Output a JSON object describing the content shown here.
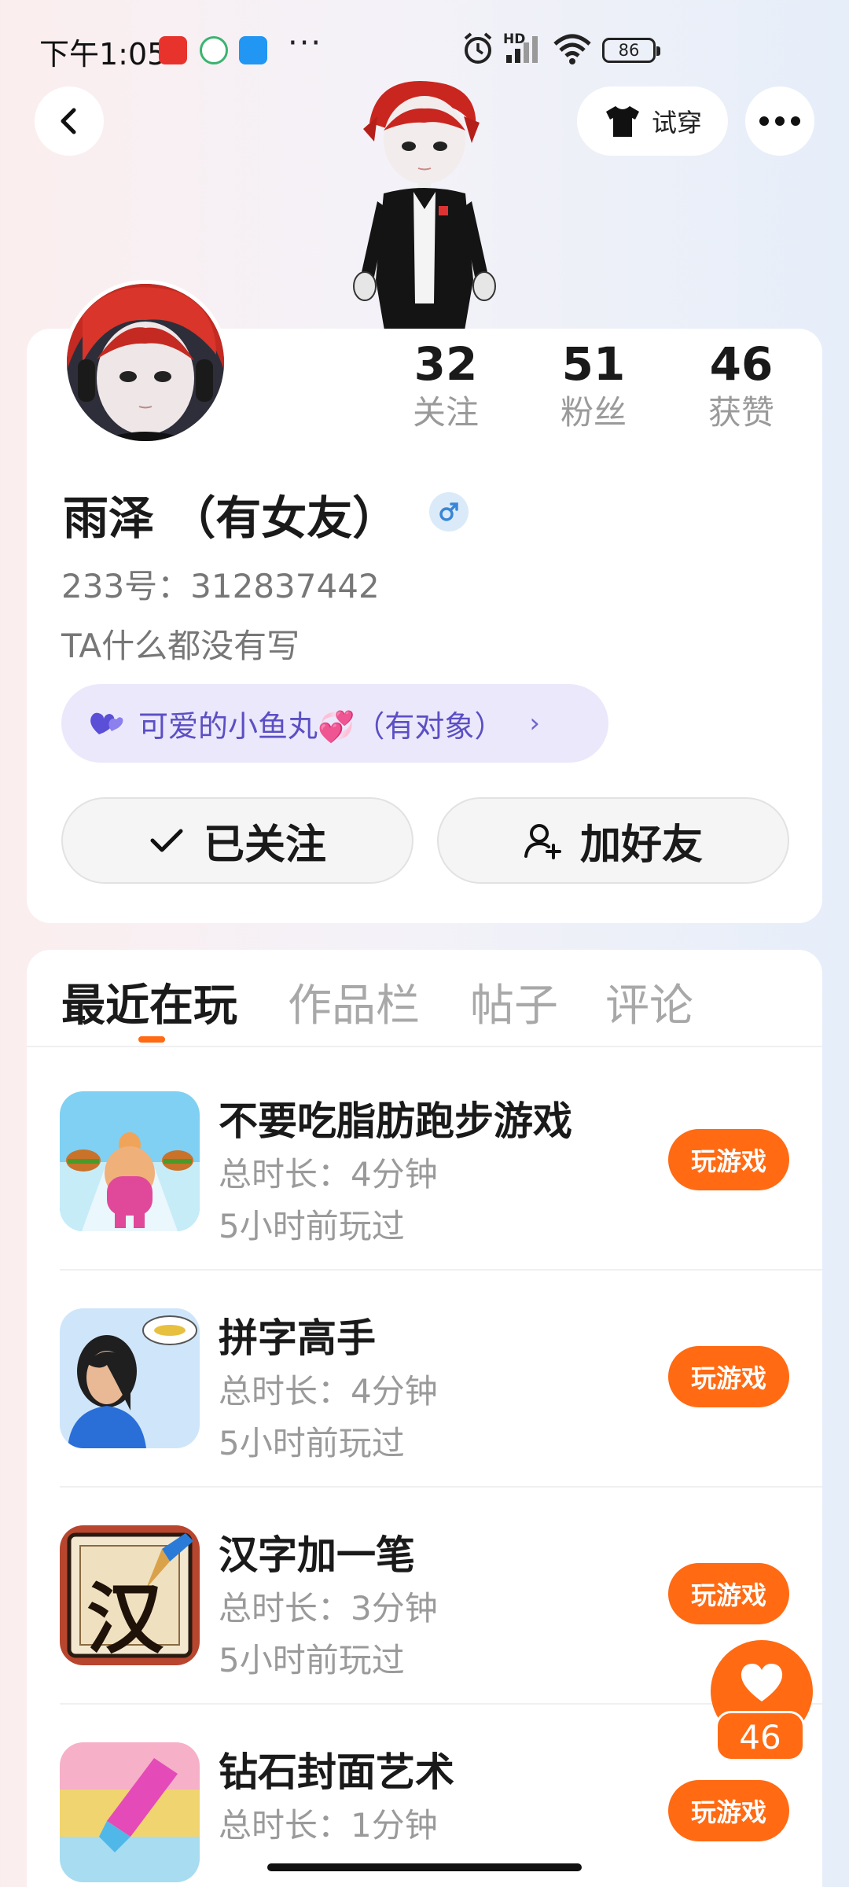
{
  "status_bar": {
    "time": "下午1:05",
    "more": "···",
    "network": "HD",
    "battery": "86"
  },
  "nav": {
    "back_icon": "chevron-left-icon",
    "tryon_label": "试穿",
    "tryon_icon": "shirt-icon",
    "more_icon": "more-dots-icon"
  },
  "profile": {
    "stats": [
      {
        "value": "32",
        "label": "关注"
      },
      {
        "value": "51",
        "label": "粉丝"
      },
      {
        "value": "46",
        "label": "获赞"
      }
    ],
    "nickname": "雨泽 （有女友）",
    "gender_icon": "male-icon",
    "uid": "233号：312837442",
    "bio": "TA什么都没有写",
    "cp_tag": "可爱的小鱼丸💞（有对象）",
    "follow_label": "已关注",
    "add_friend_label": "加好友"
  },
  "tabs": [
    {
      "label": "最近在玩",
      "active": true
    },
    {
      "label": "作品栏",
      "active": false
    },
    {
      "label": "帖子",
      "active": false
    },
    {
      "label": "评论",
      "active": false
    }
  ],
  "games": [
    {
      "title": "不要吃脂肪跑步游戏",
      "duration": "总时长：4分钟",
      "last_played": "5小时前玩过",
      "button": "玩游戏"
    },
    {
      "title": "拼字高手",
      "duration": "总时长：4分钟",
      "last_played": "5小时前玩过",
      "button": "玩游戏"
    },
    {
      "title": "汉字加一笔",
      "duration": "总时长：3分钟",
      "last_played": "5小时前玩过",
      "button": "玩游戏"
    },
    {
      "title": "钻石封面艺术",
      "duration": "总时长：1分钟",
      "last_played": "",
      "button": "玩游戏"
    }
  ],
  "game3_icon_char": "汉",
  "like_float": {
    "count": "46"
  },
  "colors": {
    "accent": "#ff6a13",
    "cp_bg": "#ebe8fb",
    "cp_text": "#5b4fc4"
  }
}
